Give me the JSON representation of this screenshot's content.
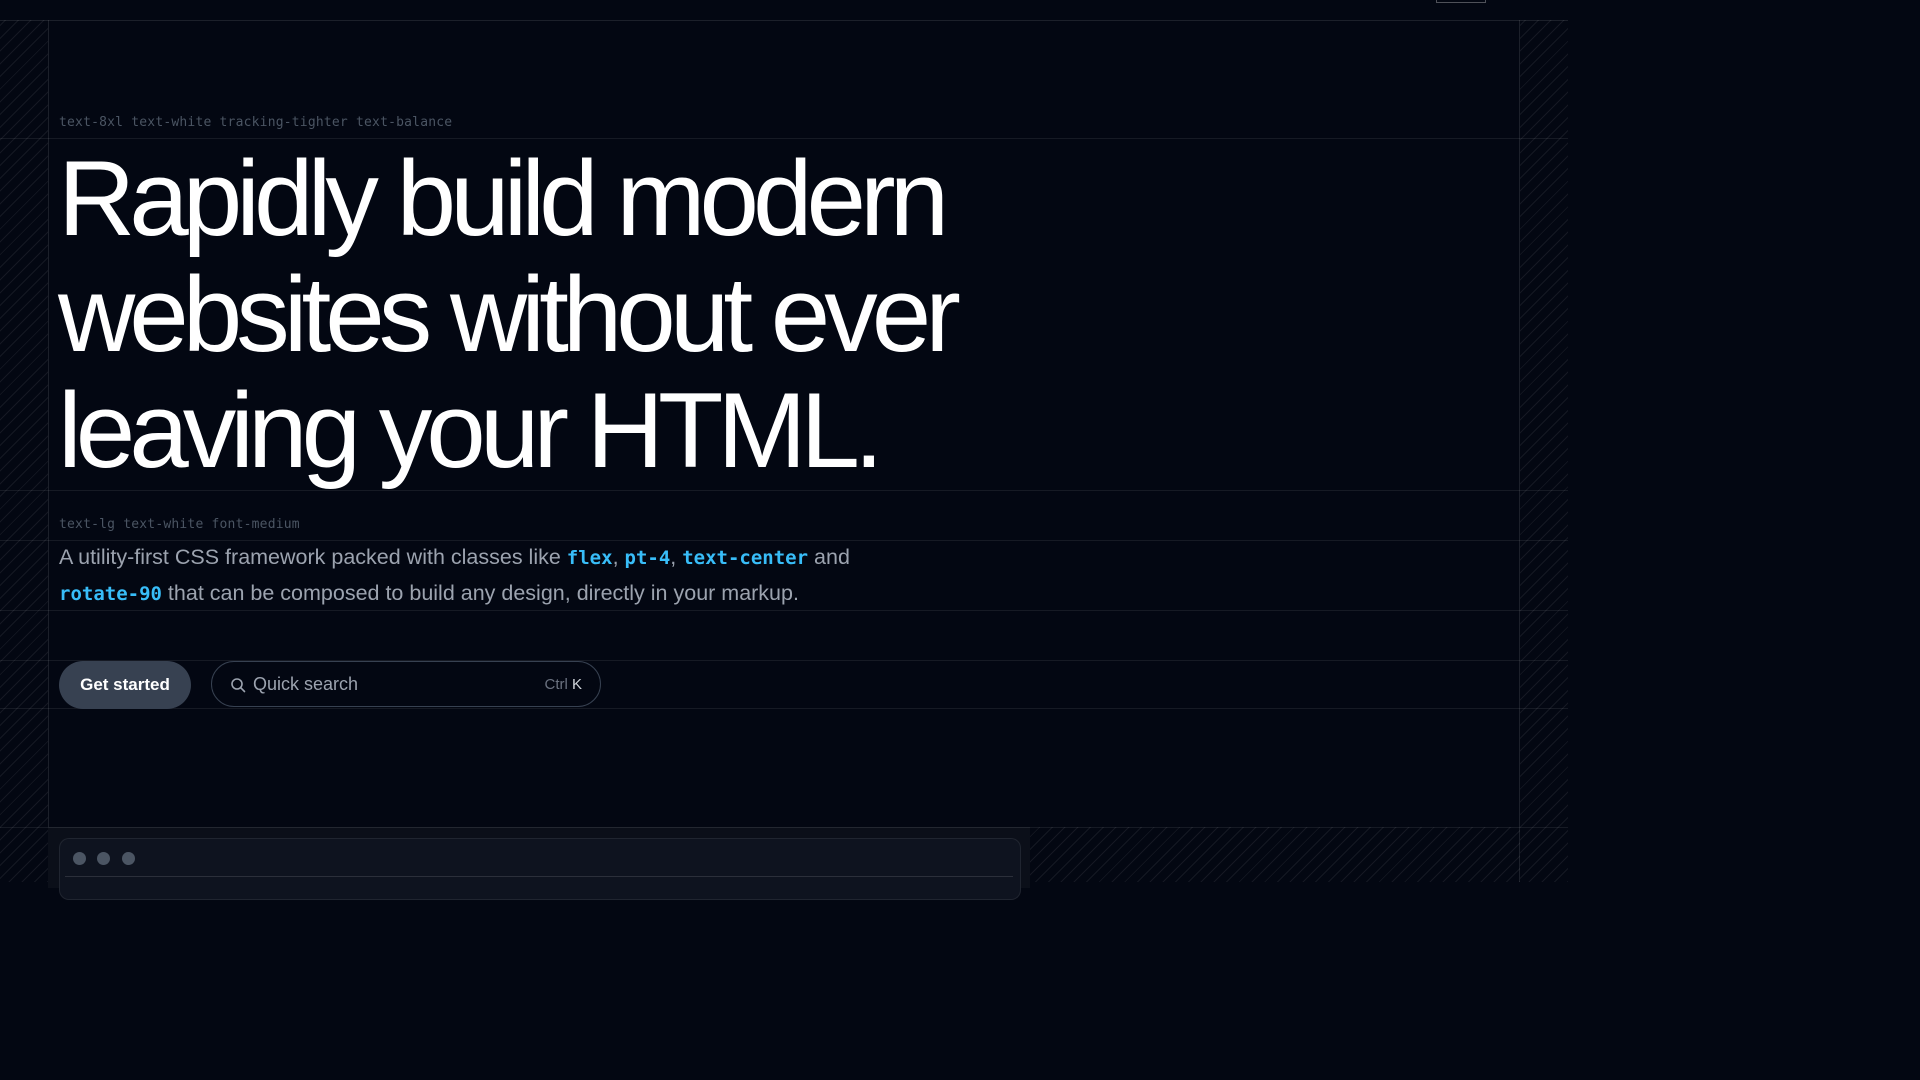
{
  "hero": {
    "label": "text-8xl text-white tracking-tighter text-balance",
    "line1": "Rapidly build modern",
    "line2": "websites without ever",
    "line3": "leaving your HTML."
  },
  "lead": {
    "label": "text-lg text-white font-medium",
    "text_before": "A utility-first CSS framework packed with classes like ",
    "code1": "flex",
    "sep1": ", ",
    "code2": "pt-4",
    "sep2": ", ",
    "code3": "text-center",
    "and": " and",
    "code4": "rotate-90",
    "text_after": " that can be composed to build any design, directly in your markup."
  },
  "actions": {
    "get_started": "Get started",
    "search_placeholder": "Quick search",
    "shortcut_mod": "Ctrl",
    "shortcut_key": "K"
  },
  "icons": {
    "search": "search-icon",
    "window_controls": [
      "close-dot",
      "minimize-dot",
      "maximize-dot"
    ]
  },
  "colors": {
    "background": "#030712",
    "accent_code": "#38bdf8",
    "button_bg": "#374151"
  }
}
